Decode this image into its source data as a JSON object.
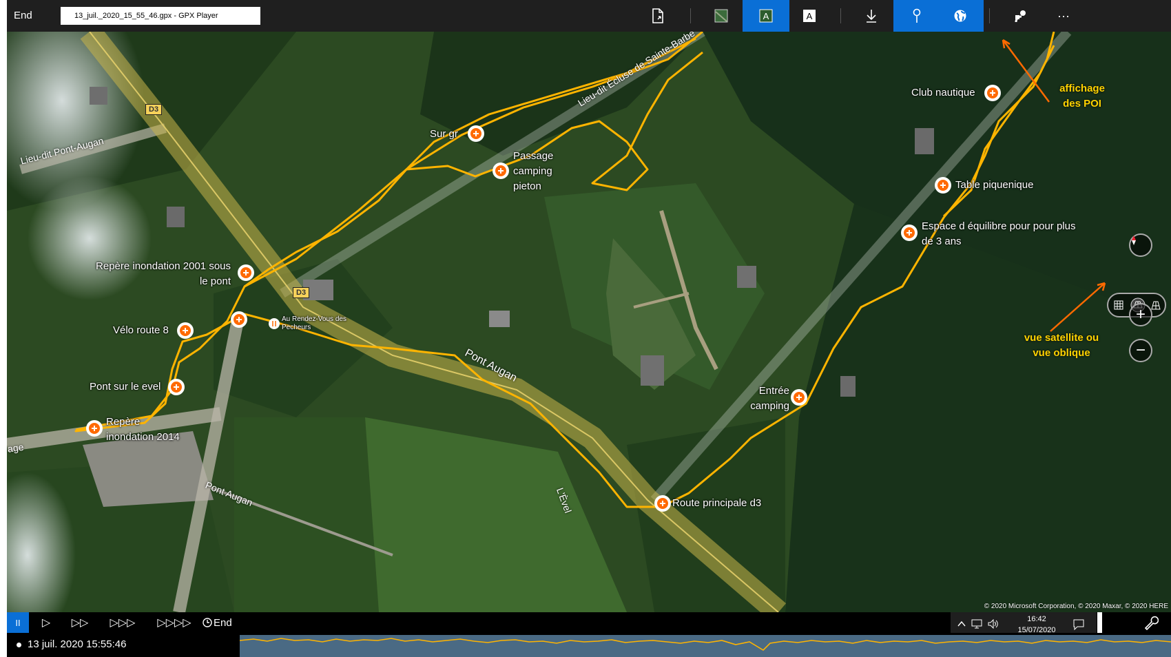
{
  "window": {
    "left_label": "End",
    "title": "13_juil._2020_15_55_46.gpx - GPX Player"
  },
  "toolbar": {
    "buttons": [
      {
        "name": "export-icon",
        "active": false
      },
      {
        "name": "map-style-icon",
        "active": false
      },
      {
        "name": "labels-on-icon",
        "active": true
      },
      {
        "name": "labels-off-icon",
        "active": false
      },
      {
        "name": "download-icon",
        "active": false
      },
      {
        "name": "poi-pin-icon",
        "active": true
      },
      {
        "name": "globe-icon",
        "active": true
      },
      {
        "name": "share-icon",
        "active": false
      },
      {
        "name": "more-icon",
        "active": false
      }
    ],
    "more_label": "···"
  },
  "map": {
    "pois": [
      {
        "label": "Sur gr"
      },
      {
        "label": "Passage camping pieton"
      },
      {
        "label": "Club nautique"
      },
      {
        "label": "Table piquenique"
      },
      {
        "label": "Espace d équilibre pour pour plus de 3 ans"
      },
      {
        "label": "Repère inondation 2001 sous le pont"
      },
      {
        "label": "Vélo route 8"
      },
      {
        "label": "Pont sur le evel"
      },
      {
        "label": "Repère inondation 2014"
      },
      {
        "label": "Entrée camping"
      },
      {
        "label": "Route principale d3"
      }
    ],
    "restaurant": "Au Rendez-Vous des Pecheurs",
    "roads": {
      "ecluse": "Lieu-dit Écluse de Sainte-Barbe",
      "pont_augan_left": "Lieu-dit Pont-Augan",
      "pont_augan_main": "Pont Augan",
      "pont_augan_lower": "Pont Augan",
      "evel": "L'Èvel",
      "age": "age",
      "d3_a": "D3",
      "d3_b": "D3"
    },
    "annotations": {
      "poi": "affichage des POI",
      "view": "vue satellite ou vue oblique"
    },
    "copyright": "© 2020 Microsoft Corporation, © 2020 Maxar, © 2020 HERE",
    "controls": {
      "compass": "compass-icon",
      "zoom_in": "+",
      "zoom_out": "−"
    },
    "colors": {
      "track": "#ffb400",
      "poi_marker": "#ff6a00",
      "annotation": "#ffd200",
      "road": "#e8d27a"
    }
  },
  "playback": {
    "buttons": [
      "II",
      "▷",
      "▷▷",
      "▷▷▷",
      "▷▷▷▷"
    ],
    "end_label": "End",
    "date": "13 juil. 2020 15:55:46"
  },
  "tray": {
    "time": "16:42",
    "date": "15/07/2020"
  }
}
